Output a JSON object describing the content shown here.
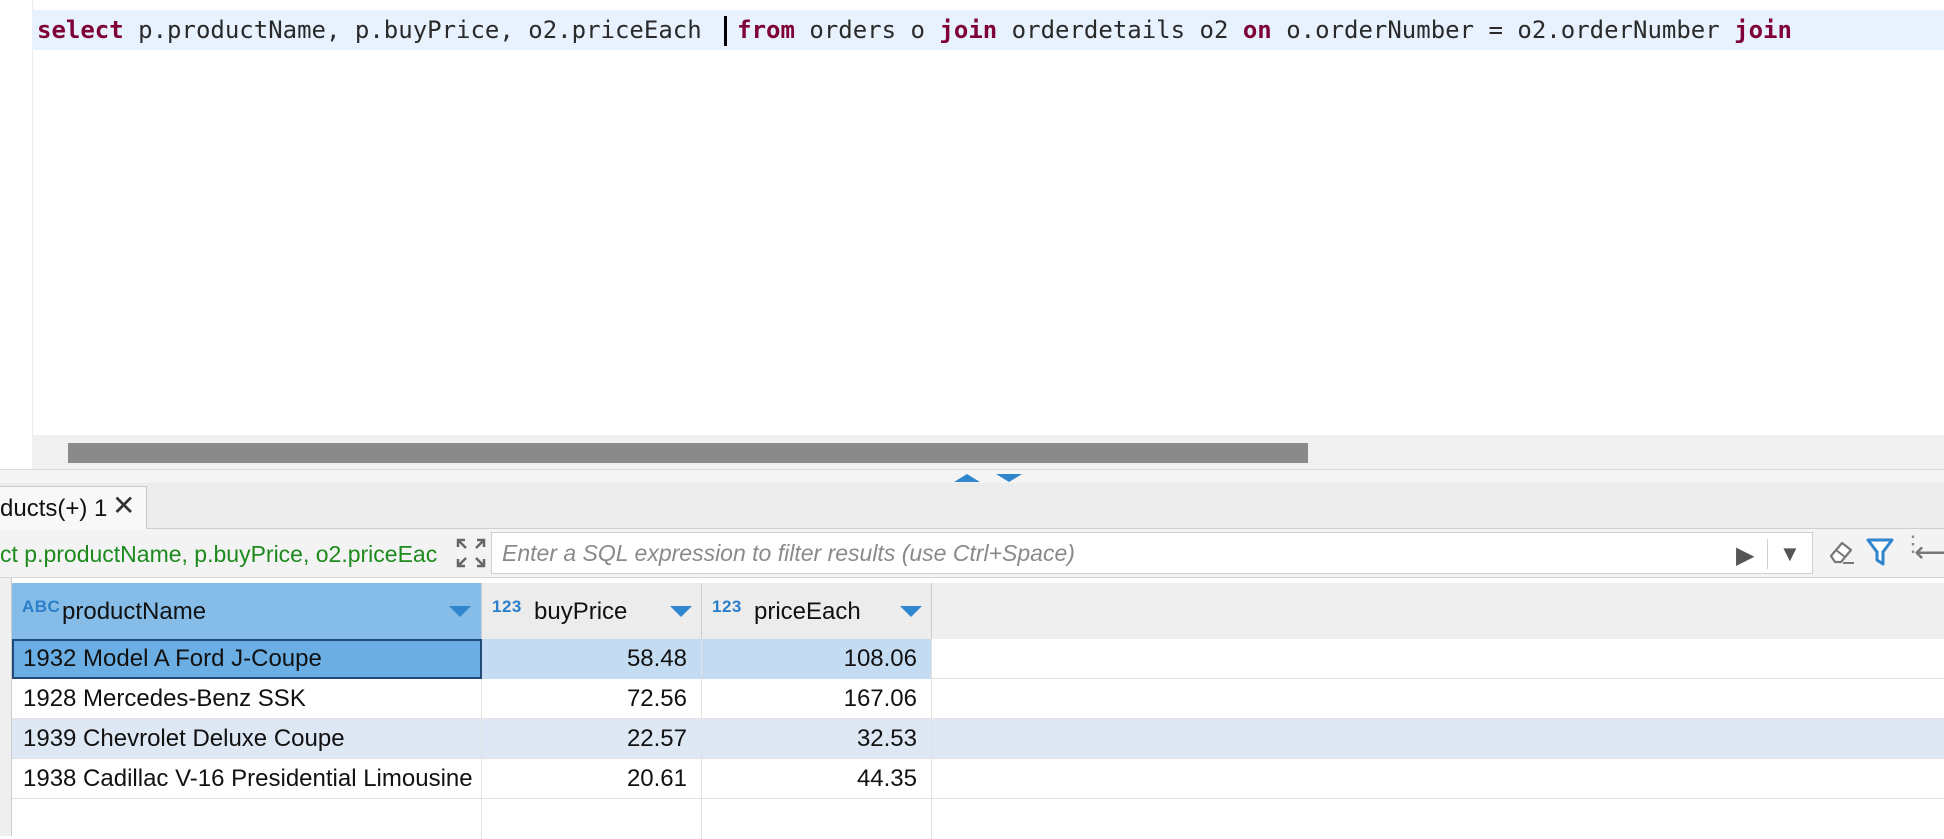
{
  "editor": {
    "sql_parts": [
      {
        "type": "kw",
        "text": "select"
      },
      {
        "type": "txt",
        "text": " p.productName, p.buyPrice, o2.priceEach "
      },
      {
        "type": "caret",
        "text": ""
      },
      {
        "type": "kw",
        "text": "from"
      },
      {
        "type": "txt",
        "text": " orders o "
      },
      {
        "type": "kw",
        "text": "join"
      },
      {
        "type": "txt",
        "text": " orderdetails o2 "
      },
      {
        "type": "kw",
        "text": "on"
      },
      {
        "type": "txt",
        "text": " o.orderNumber = o2.orderNumber "
      },
      {
        "type": "kw",
        "text": "join"
      }
    ]
  },
  "results_tab": {
    "label": "ducts(+) 1",
    "close_icon": "close-icon"
  },
  "filter_bar": {
    "query_preview": "ct p.productName, p.buyPrice, o2.priceEac",
    "placeholder": "Enter a SQL expression to filter results (use Ctrl+Space)"
  },
  "grid": {
    "columns": [
      {
        "type": "ABC",
        "name": "productName"
      },
      {
        "type": "123",
        "name": "buyPrice"
      },
      {
        "type": "123",
        "name": "priceEach"
      }
    ],
    "rows": [
      [
        "1932 Model A Ford J-Coupe",
        "58.48",
        "108.06"
      ],
      [
        "1928 Mercedes-Benz SSK",
        "72.56",
        "167.06"
      ],
      [
        "1939 Chevrolet Deluxe Coupe",
        "22.57",
        "32.53"
      ],
      [
        "1938 Cadillac V-16 Presidential Limousine",
        "20.61",
        "44.35"
      ]
    ]
  },
  "colors": {
    "keyword": "#7f0036",
    "current_line": "#e8f2fe",
    "accent": "#2f86cc",
    "preview_text": "#1d8a1d",
    "selected_header": "#86bde8"
  }
}
